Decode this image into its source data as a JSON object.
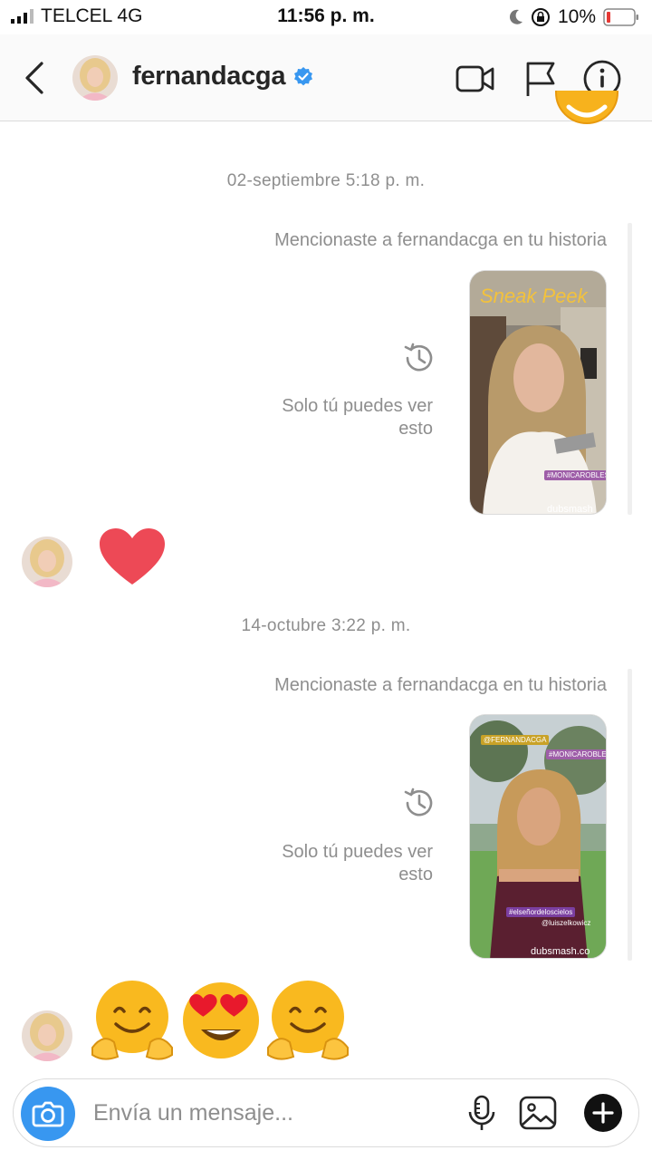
{
  "status_bar": {
    "carrier": "TELCEL  4G",
    "time": "11:56 p. m.",
    "battery_percent": "10%"
  },
  "header": {
    "username": "fernandacga",
    "verified": true,
    "icons": [
      "back-icon",
      "video-call-icon",
      "flag-icon",
      "info-icon"
    ]
  },
  "thread": {
    "messages": [
      {
        "timestamp": "02-septiembre 5:18 p. m.",
        "mention_note": "Mencionaste a fernandacga en tu historia",
        "private_note": "Solo tú puedes ver esto",
        "story_overlay": {
          "title": "Sneak Peek",
          "hashtag": "#MONICAROBLES",
          "watermark": "dubsmash"
        },
        "reply_reaction": "heart"
      },
      {
        "timestamp": "14-octubre 3:22 p. m.",
        "mention_note": "Mencionaste a fernandacga en tu historia",
        "private_note": "Solo tú puedes ver esto",
        "story_overlay": {
          "mention_tag": "@FERNANDACGA",
          "hashtag": "#MONICAROBLES",
          "caption_1": "#elseñordeloscielos",
          "caption_2": "@luiszelkowicz",
          "watermark": "dubsmash.co"
        },
        "reply_reaction": "emojis"
      }
    ]
  },
  "composer": {
    "placeholder": "Envía un mensaje..."
  },
  "colors": {
    "accent_blue": "#3897f0",
    "heart_red": "#ed4956",
    "secondary_text": "#8e8e8e"
  }
}
